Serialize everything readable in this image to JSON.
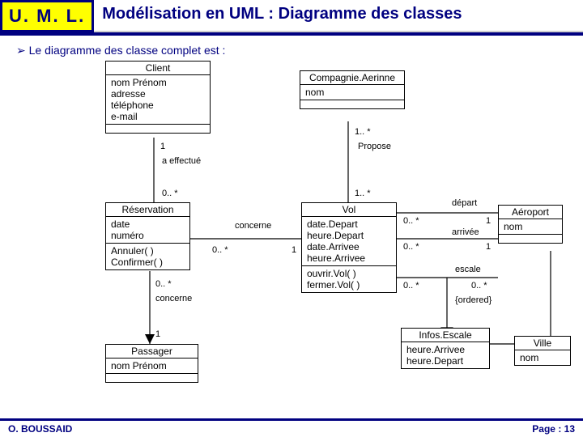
{
  "header": {
    "badge": "U. M. L.",
    "title": "Modélisation en UML : Diagramme des classes"
  },
  "intro": "Le diagramme des classe complet est :",
  "client": {
    "name": "Client",
    "attrs": "nom Prénom\nadresse\ntéléphone\ne-mail"
  },
  "compagnie": {
    "name": "Compagnie.Aerinne",
    "attrs": "nom"
  },
  "reservation": {
    "name": "Réservation",
    "attrs": "date\nnuméro",
    "ops": "Annuler( )\nConfirmer( )"
  },
  "vol": {
    "name": "Vol",
    "attrs": "date.Depart\nheure.Depart\ndate.Arrivee\nheure.Arrivee",
    "ops": "ouvrir.Vol( )\nfermer.Vol( )"
  },
  "aeroport": {
    "name": "Aéroport",
    "attrs": "nom"
  },
  "infos": {
    "name": "Infos.Escale",
    "attrs": "heure.Arrivee\nheure.Depart"
  },
  "passager": {
    "name": "Passager",
    "attrs": "nom Prénom"
  },
  "ville": {
    "name": "Ville",
    "attrs": "nom"
  },
  "assoc": {
    "client_res_top": "1",
    "client_res_name": "a effectué",
    "client_res_bot": "0.. *",
    "comp_vol_top": "1.. *",
    "comp_vol_name": "Propose",
    "comp_vol_bot": "1.. *",
    "res_vol_name": "concerne",
    "res_vol_left": "0.. *",
    "res_vol_right": "1",
    "res_pas_top": "0.. *",
    "res_pas_name": "concerne",
    "res_pas_bot": "1",
    "vol_aer_dep_name": "départ",
    "vol_aer_dep_l": "0.. *",
    "vol_aer_dep_r": "1",
    "vol_aer_arr_name": "arrivée",
    "vol_aer_arr_l": "0.. *",
    "vol_aer_arr_r": "1",
    "vol_aer_esc_name": "escale",
    "vol_aer_esc_l": "0.. *",
    "vol_aer_esc_r": "0.. *",
    "ordered": "{ordered}"
  },
  "footer": {
    "author": "O. BOUSSAID",
    "page": "Page : 13"
  }
}
